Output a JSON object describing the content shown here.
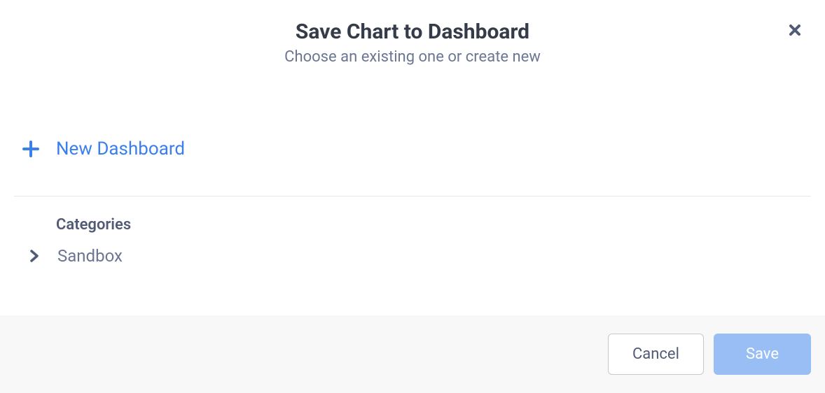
{
  "modal": {
    "title": "Save Chart to Dashboard",
    "subtitle": "Choose an existing one or create new",
    "new_dashboard_label": "New Dashboard",
    "categories_label": "Categories",
    "categories": [
      {
        "label": "Sandbox"
      }
    ],
    "cancel_label": "Cancel",
    "save_label": "Save"
  }
}
